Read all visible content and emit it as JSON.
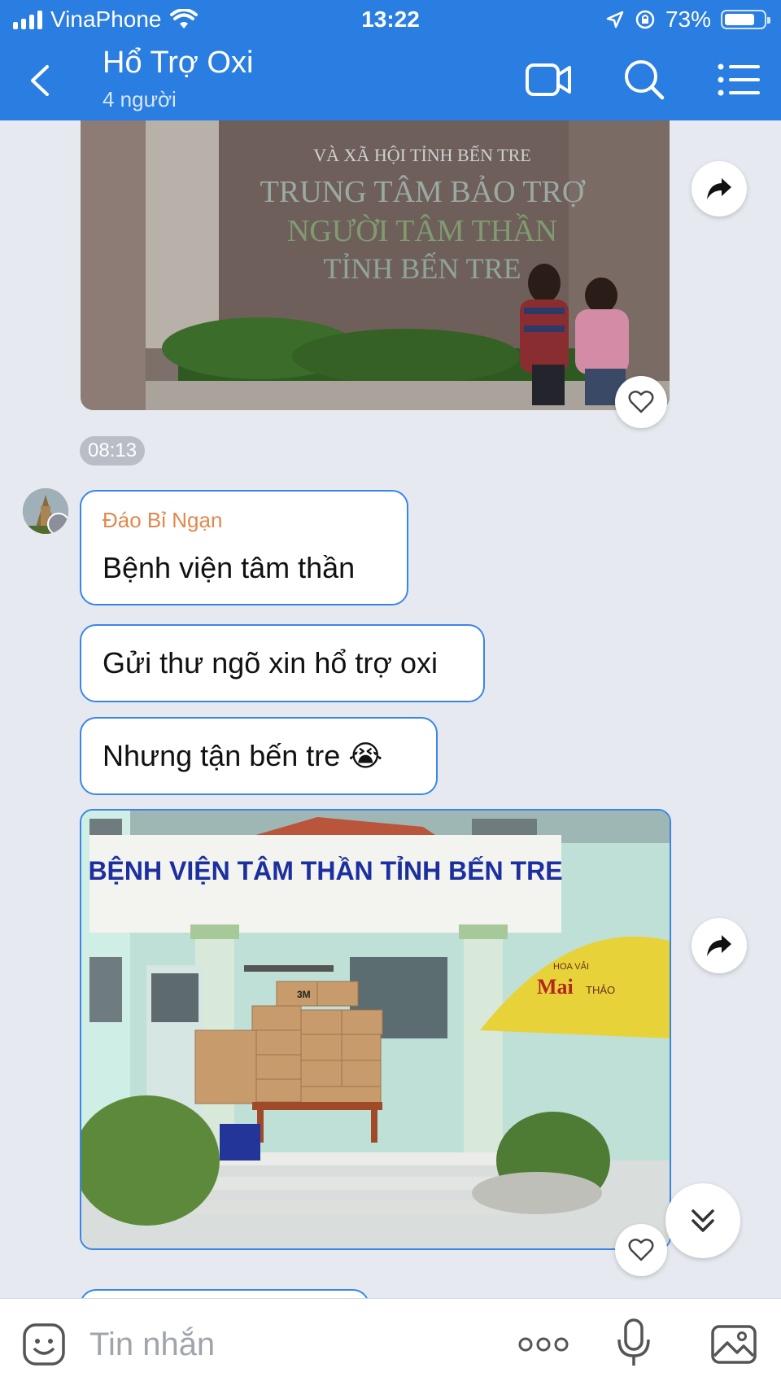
{
  "status": {
    "carrier": "VinaPhone",
    "time": "13:22",
    "battery": "73%"
  },
  "header": {
    "title": "Hổ Trợ Oxi",
    "subtitle": "4 người"
  },
  "messages": {
    "time1": "08:13",
    "sender": "Đáo Bỉ Ngạn",
    "text1": "Bệnh viện tâm thần",
    "text2": "Gửi thư ngõ xin hổ trợ oxi",
    "text3": "Nhưng tận bến tre 😭"
  },
  "photo1": {
    "sign_line1": "VÀ XÃ HỘI TỈNH BẾN TRE",
    "sign_line2": "TRUNG TÂM BẢO TRỢ",
    "sign_line3": "NGƯỜI TÂM THẦN",
    "sign_line4": "TỈNH BẾN TRE"
  },
  "photo2": {
    "sign": "BỆNH VIỆN TÂM THẦN TỈNH BẾN TRE",
    "box_brand": "3M",
    "umbrella_brand": "Mai",
    "umbrella_top": "HOA VẢI",
    "umbrella_right": "THẢO"
  },
  "composer": {
    "placeholder": "Tin nhắn"
  },
  "colors": {
    "header": "#2a7de1",
    "accent": "#3a86e8",
    "sender": "#e0894d",
    "chat_bg": "#e6e9f0"
  }
}
